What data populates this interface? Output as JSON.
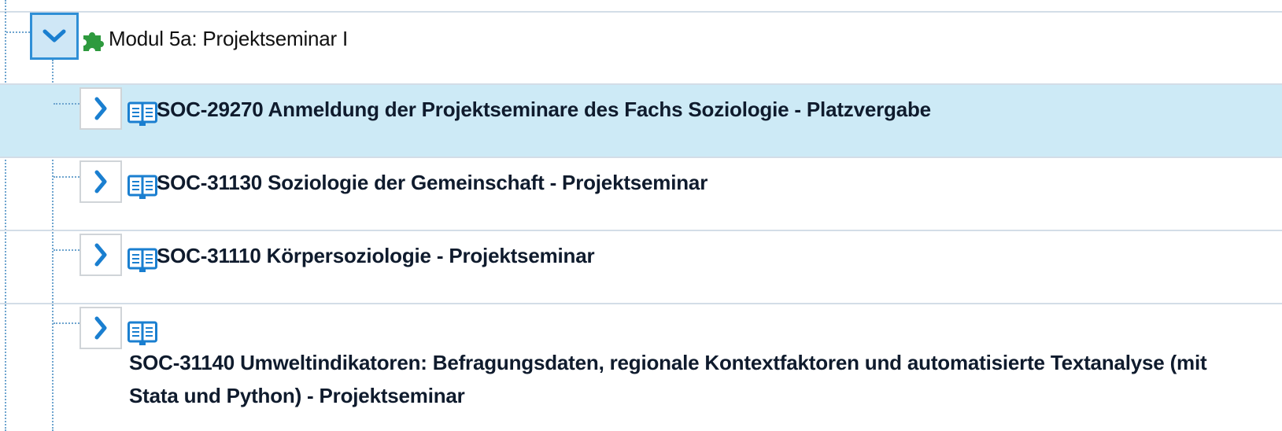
{
  "module": {
    "label": "Modul 5a: Projektseminar I",
    "icon": "puzzle-icon",
    "expanded": true,
    "toggle_icon": "chevron-down-icon"
  },
  "courses": [
    {
      "label": "SOC-29270 Anmeldung der Projektseminare des Fachs Soziologie - Platzvergabe",
      "selected": true,
      "icon": "open-book-icon",
      "toggle_icon": "chevron-right-icon"
    },
    {
      "label": "SOC-31130 Soziologie der Gemeinschaft - Projektseminar",
      "selected": false,
      "icon": "open-book-icon",
      "toggle_icon": "chevron-right-icon"
    },
    {
      "label": "SOC-31110 Körpersoziologie - Projektseminar",
      "selected": false,
      "icon": "open-book-icon",
      "toggle_icon": "chevron-right-icon"
    },
    {
      "label": "SOC-31140 Umweltindikatoren: Befragungsdaten, regionale Kontextfaktoren und automatisierte Textanalyse (mit Stata und Python) - Projektseminar",
      "selected": false,
      "icon": "open-book-icon",
      "toggle_icon": "chevron-right-icon"
    }
  ],
  "colors": {
    "accent": "#1a7fd0",
    "selected_row": "#cdeaf6",
    "puzzle": "#2e9a3e",
    "tree_line": "#6fa5cf"
  }
}
